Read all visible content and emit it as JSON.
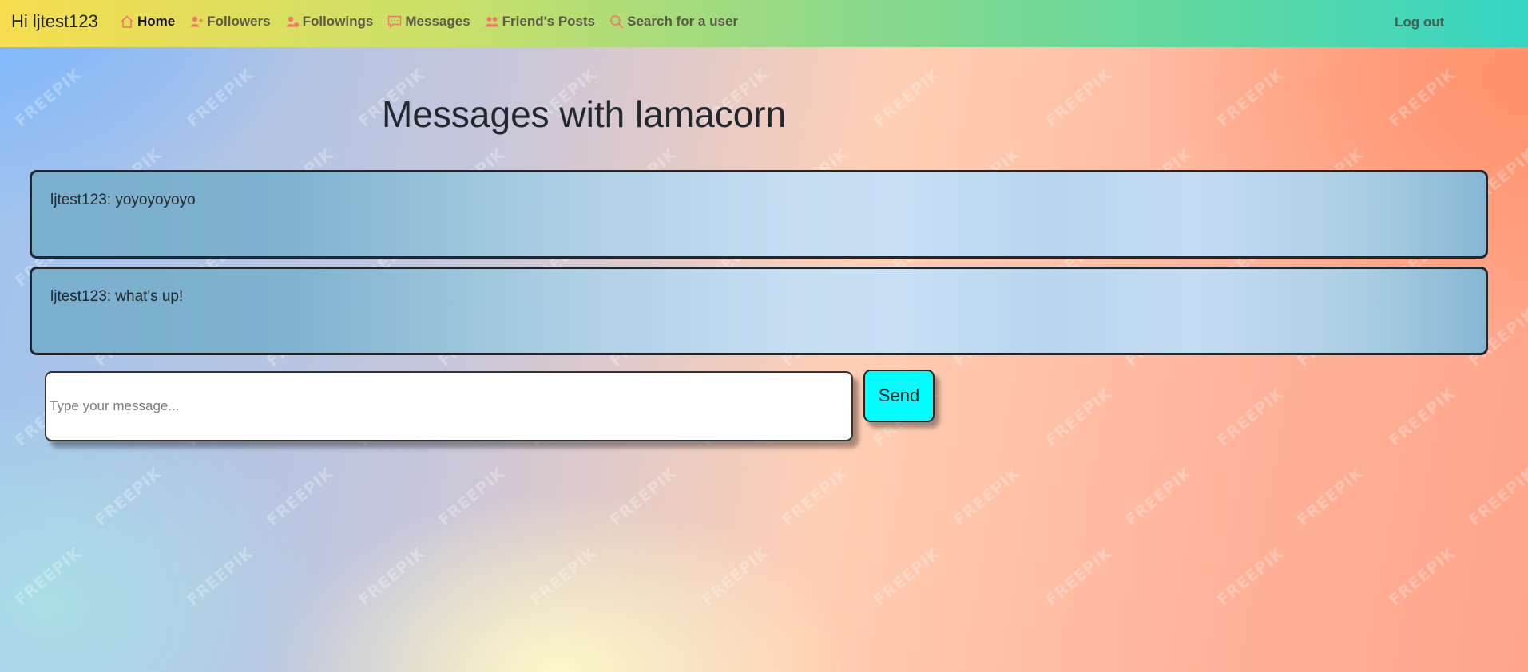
{
  "navbar": {
    "greeting": "Hi ljtest123",
    "items": [
      {
        "label": "Home",
        "icon": "home-icon",
        "active": true
      },
      {
        "label": "Followers",
        "icon": "user-plus-icon",
        "active": false
      },
      {
        "label": "Followings",
        "icon": "user-check-icon",
        "active": false
      },
      {
        "label": "Messages",
        "icon": "chat-icon",
        "active": false
      },
      {
        "label": "Friend's Posts",
        "icon": "users-icon",
        "active": false
      },
      {
        "label": "Search for a user",
        "icon": "search-icon",
        "active": false
      }
    ],
    "logout_label": "Log out",
    "icon_color": "#f0776a"
  },
  "page": {
    "title": "Messages with lamacorn"
  },
  "messages": [
    {
      "text": "ljtest123: yoyoyoyoyo"
    },
    {
      "text": "ljtest123: what's up!"
    }
  ],
  "composer": {
    "placeholder": "Type your message...",
    "value": "",
    "send_label": "Send",
    "send_color": "#00ffff"
  },
  "watermark_text": "FREEPIK"
}
